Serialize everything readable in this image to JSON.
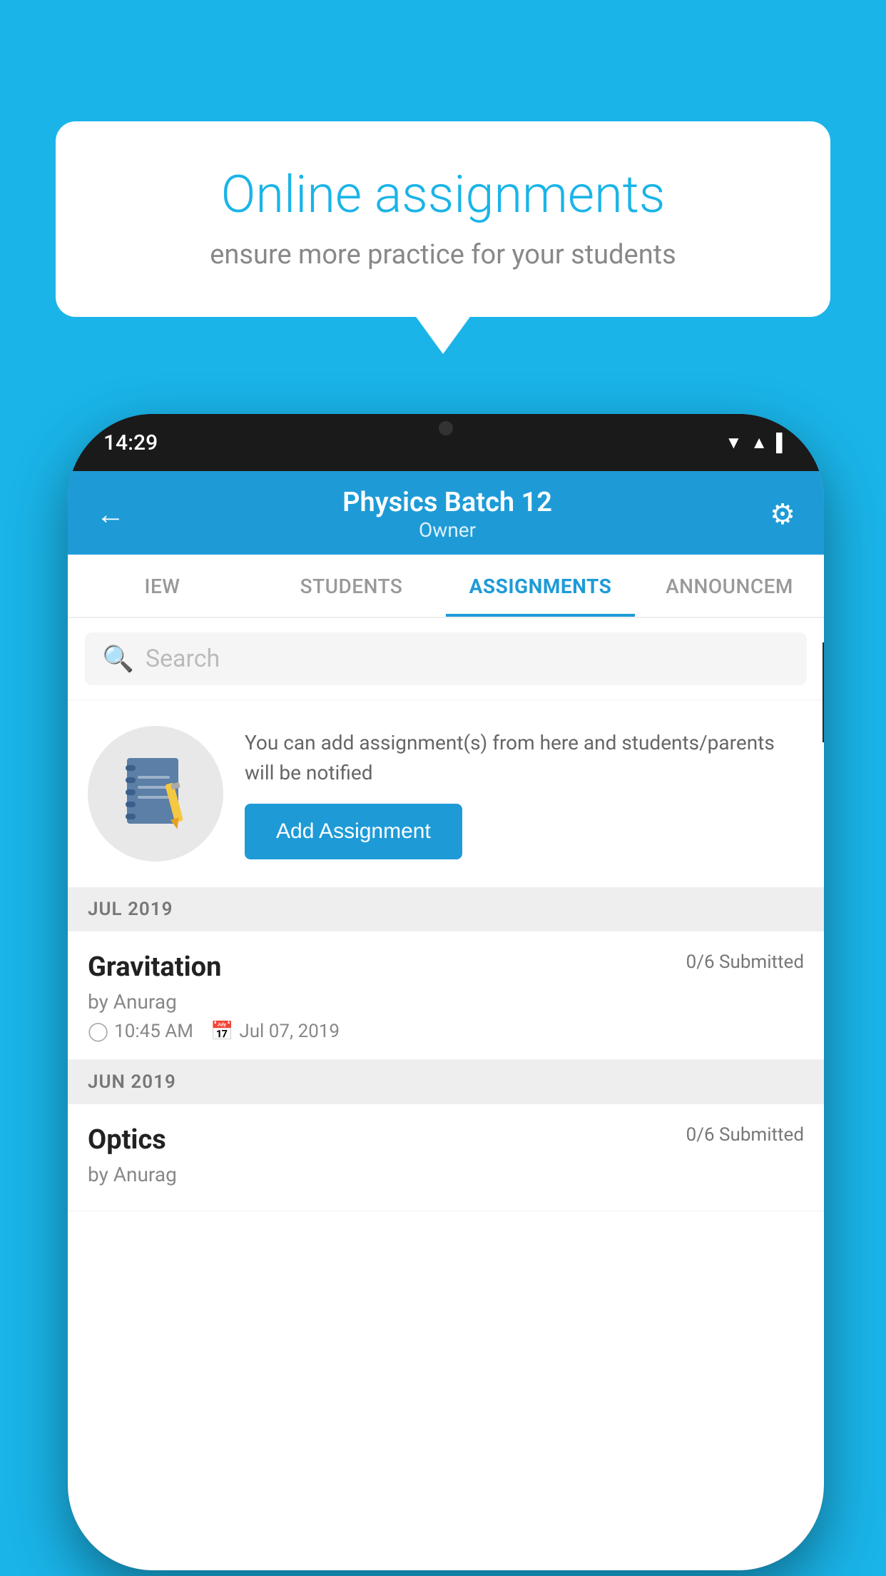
{
  "background_color": "#1ab4e8",
  "speech_bubble": {
    "title": "Online assignments",
    "subtitle": "ensure more practice for your students"
  },
  "phone": {
    "status_bar": {
      "time": "14:29",
      "signal_icons": [
        "▼▲",
        "▲",
        "▌"
      ]
    },
    "header": {
      "title": "Physics Batch 12",
      "subtitle": "Owner",
      "back_label": "←",
      "settings_label": "⚙"
    },
    "tabs": [
      {
        "label": "IEW",
        "active": false
      },
      {
        "label": "STUDENTS",
        "active": false
      },
      {
        "label": "ASSIGNMENTS",
        "active": true
      },
      {
        "label": "ANNOUNCEM",
        "active": false
      }
    ],
    "search": {
      "placeholder": "Search"
    },
    "add_assignment_section": {
      "description": "You can add assignment(s) from here and students/parents will be notified",
      "button_label": "Add Assignment"
    },
    "sections": [
      {
        "header": "JUL 2019",
        "assignments": [
          {
            "title": "Gravitation",
            "submitted": "0/6 Submitted",
            "by": "by Anurag",
            "time": "10:45 AM",
            "date": "Jul 07, 2019"
          }
        ]
      },
      {
        "header": "JUN 2019",
        "assignments": [
          {
            "title": "Optics",
            "submitted": "0/6 Submitted",
            "by": "by Anurag",
            "time": "",
            "date": ""
          }
        ]
      }
    ]
  }
}
